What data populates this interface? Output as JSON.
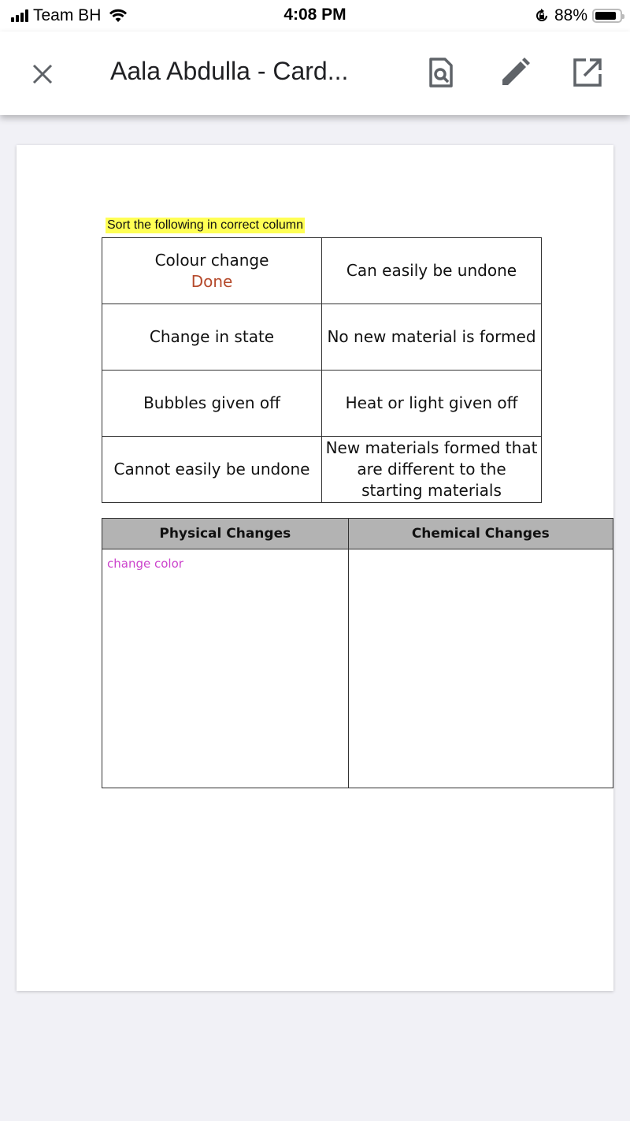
{
  "status_bar": {
    "carrier": "Team BH",
    "time": "4:08 PM",
    "battery_percent": "88%",
    "battery_level": 0.88,
    "icons": [
      "signal-icon",
      "wifi-icon",
      "rotation-lock-icon",
      "battery-icon"
    ]
  },
  "app_bar": {
    "title": "Aala Abdulla - Card...",
    "buttons": [
      {
        "name": "close",
        "icon": "close-icon"
      },
      {
        "name": "find-in-document",
        "icon": "document-search-icon"
      },
      {
        "name": "edit",
        "icon": "pencil-icon"
      },
      {
        "name": "open-external",
        "icon": "open-in-new-icon"
      }
    ]
  },
  "document": {
    "instruction": "Sort the following in correct column",
    "cards": [
      [
        "Colour change",
        "Can easily be undone"
      ],
      [
        "Change in state",
        "No new material is formed"
      ],
      [
        "Bubbles given off",
        "Heat or light given off"
      ],
      [
        "Cannot easily be undone",
        "New materials formed that are different to the starting materials"
      ]
    ],
    "card_annotation": "Done",
    "sort_table": {
      "headers": [
        "Physical Changes",
        "Chemical Changes"
      ],
      "physical_entries": [
        "change color"
      ],
      "chemical_entries": []
    }
  },
  "colors": {
    "highlight": "#ffff55",
    "done_annotation": "#b54a2c",
    "answer_text": "#cc44cc",
    "header_fill": "#b3b3b3",
    "background": "#f1f1f6"
  }
}
